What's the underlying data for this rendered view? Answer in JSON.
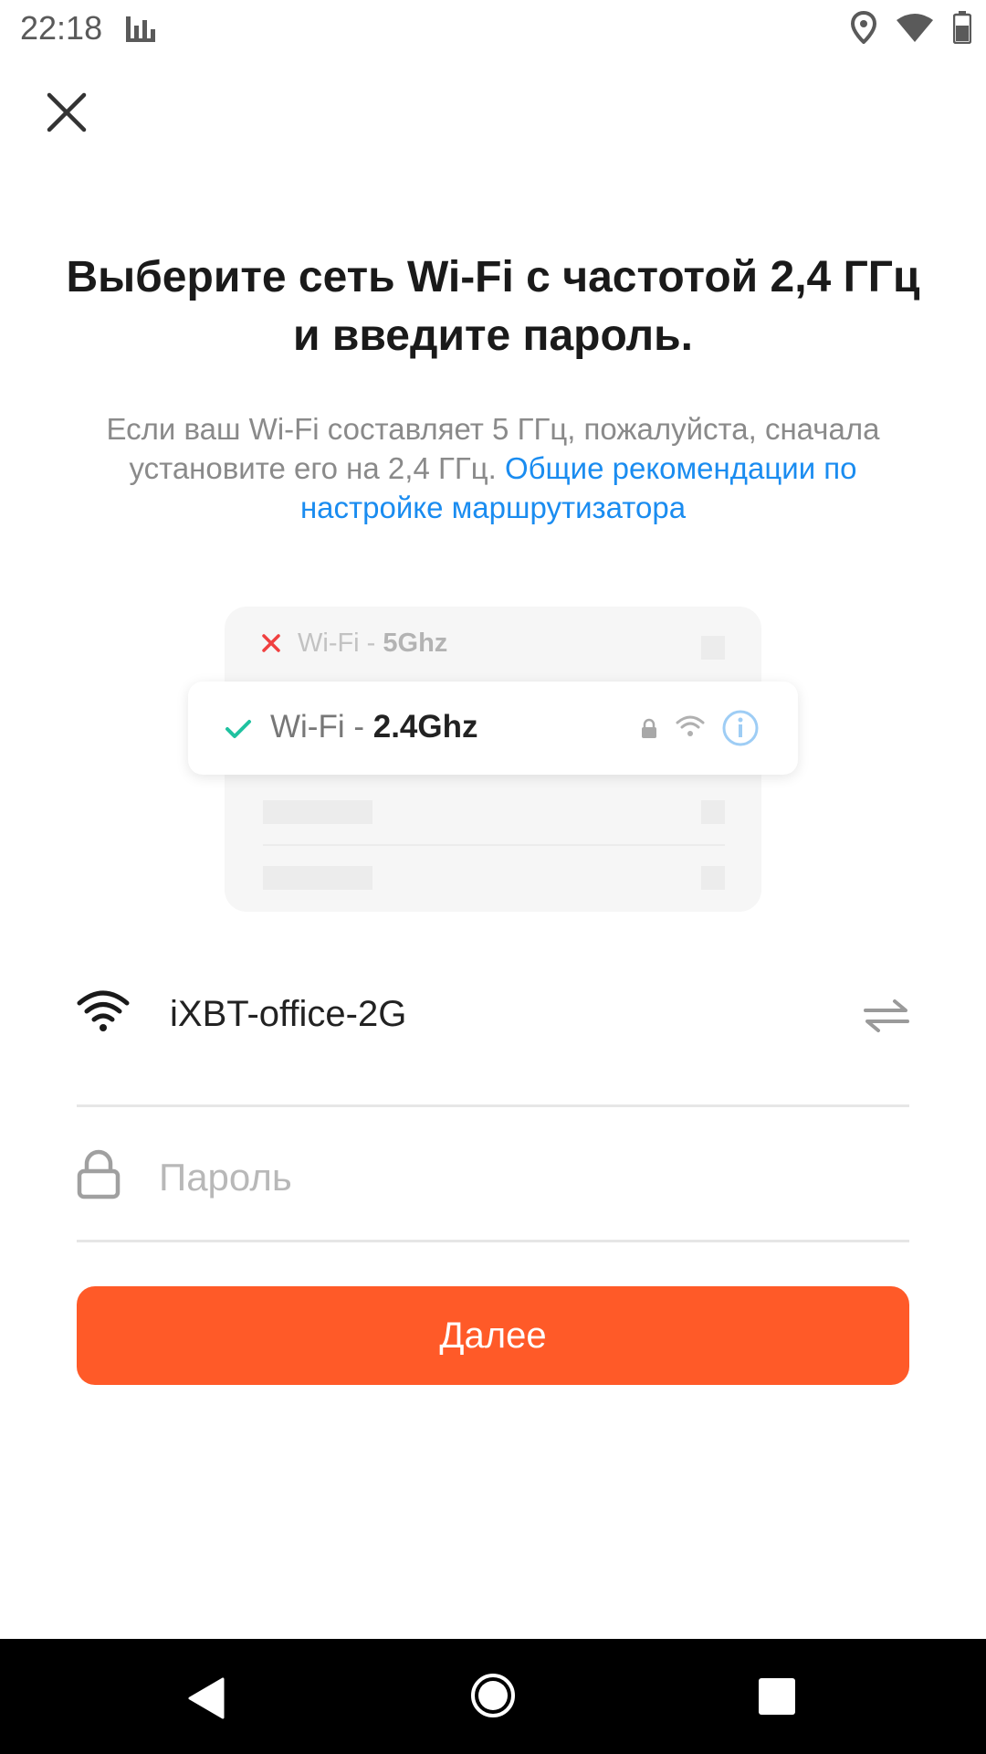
{
  "status_bar": {
    "time": "22:18"
  },
  "header": {
    "title": "Выберите сеть Wi-Fi с частотой 2,4 ГГц и введите пароль.",
    "subtitle_text": "Если ваш Wi-Fi составляет 5 ГГц, пожалуйста, сначала установите его на 2,4 ГГц. ",
    "subtitle_link": "Общие рекомендации по настройке маршрутизатора"
  },
  "illustration": {
    "row_5g": {
      "prefix": "Wi-Fi - ",
      "band": "5Ghz"
    },
    "row_24g": {
      "prefix": "Wi-Fi - ",
      "band": "2.4Ghz"
    }
  },
  "form": {
    "ssid": "iXBT-office-2G",
    "password_placeholder": "Пароль",
    "next_label": "Далее"
  },
  "colors": {
    "accent": "#ff5a28",
    "link": "#1a8cf0",
    "check": "#1fc2a0",
    "cross": "#f04040"
  }
}
